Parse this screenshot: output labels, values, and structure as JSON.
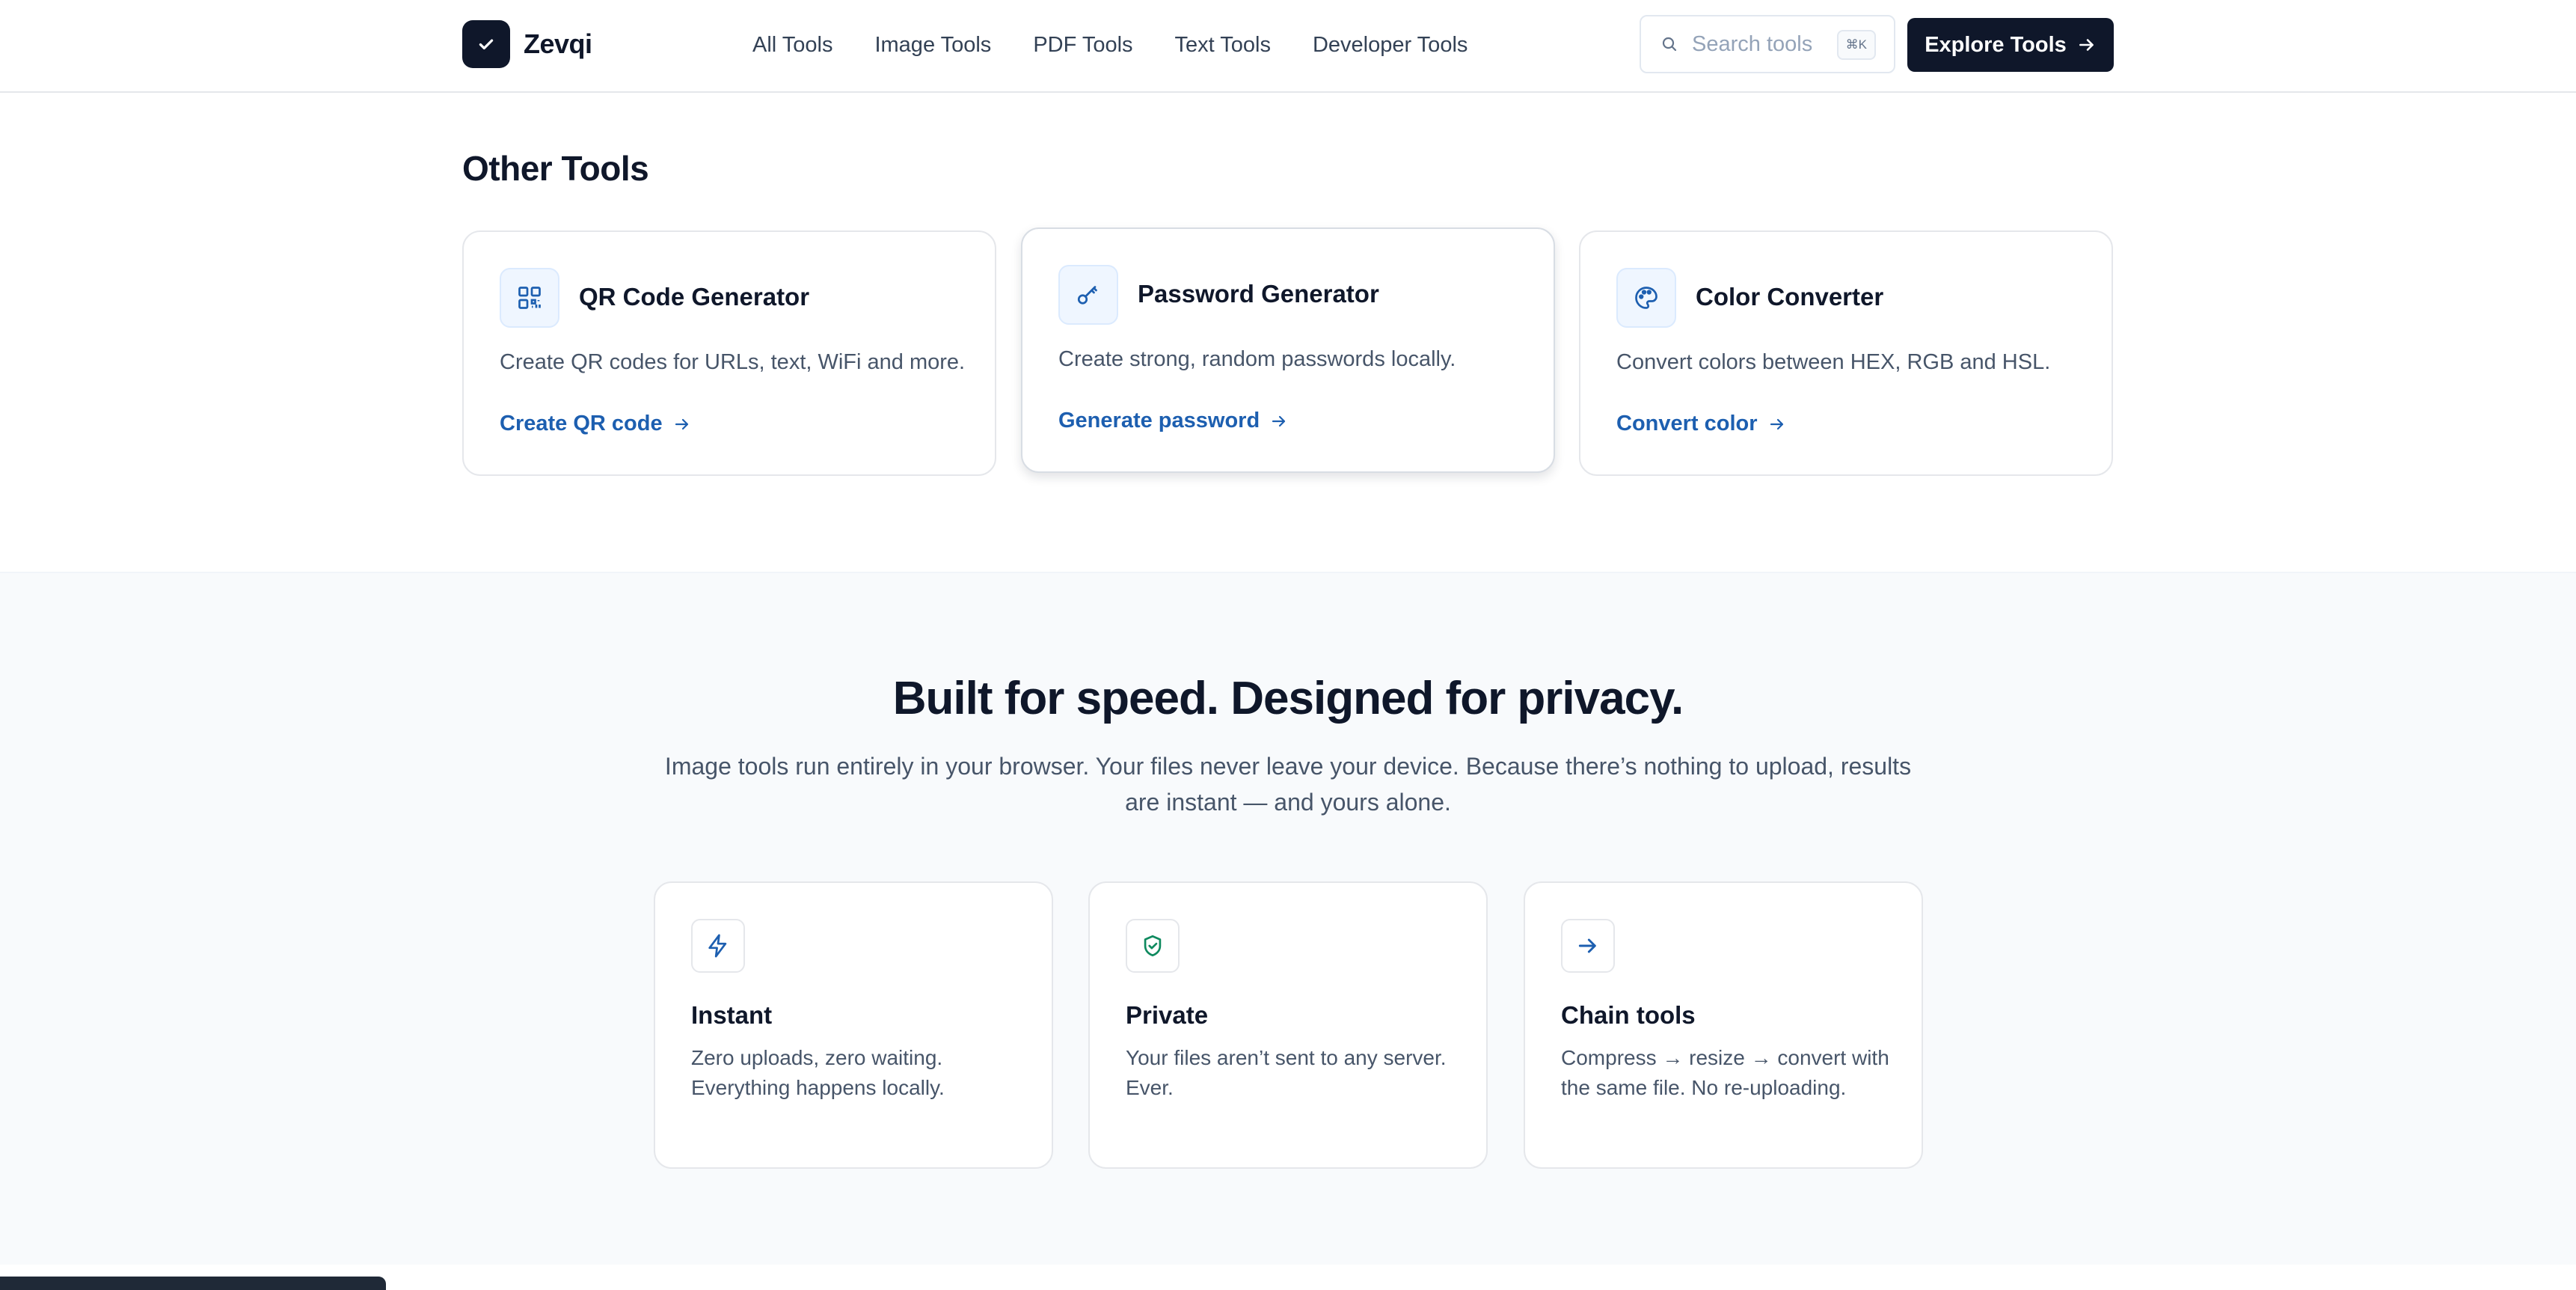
{
  "header": {
    "logo_text": "Zevqi",
    "nav": [
      "All Tools",
      "Image Tools",
      "PDF Tools",
      "Text Tools",
      "Developer Tools"
    ],
    "search_placeholder": "Search tools",
    "search_shortcut": "⌘K",
    "cta_label": "Explore Tools"
  },
  "other_tools": {
    "title": "Other Tools",
    "cards": [
      {
        "icon": "qr-code-icon",
        "name": "QR Code Generator",
        "desc": "Create QR codes for URLs, text, WiFi and more.",
        "link": "Create QR code"
      },
      {
        "icon": "key-icon",
        "name": "Password Generator",
        "desc": "Create strong, random passwords locally.",
        "link": "Generate password"
      },
      {
        "icon": "palette-icon",
        "name": "Color Converter",
        "desc": "Convert colors between HEX, RGB and HSL.",
        "link": "Convert color"
      }
    ]
  },
  "speed": {
    "title": "Built for speed. Designed for privacy.",
    "subtitle": "Image tools run entirely in your browser. Your files never leave your device. Because there’s nothing to upload, results are instant — and yours alone.",
    "features": [
      {
        "icon": "lightning-icon",
        "title": "Instant",
        "desc": "Zero uploads, zero waiting. Everything happens locally."
      },
      {
        "icon": "shield-check-icon",
        "title": "Private",
        "desc": "Your files aren’t sent to any server. Ever."
      },
      {
        "icon": "arrow-right-icon",
        "title": "Chain tools",
        "desc": "Compress → resize → convert with the same file. No re-uploading."
      }
    ]
  },
  "colors": {
    "accent": "#1d5fb0",
    "dark": "#0f172a",
    "band_bg": "#f8fafc"
  }
}
